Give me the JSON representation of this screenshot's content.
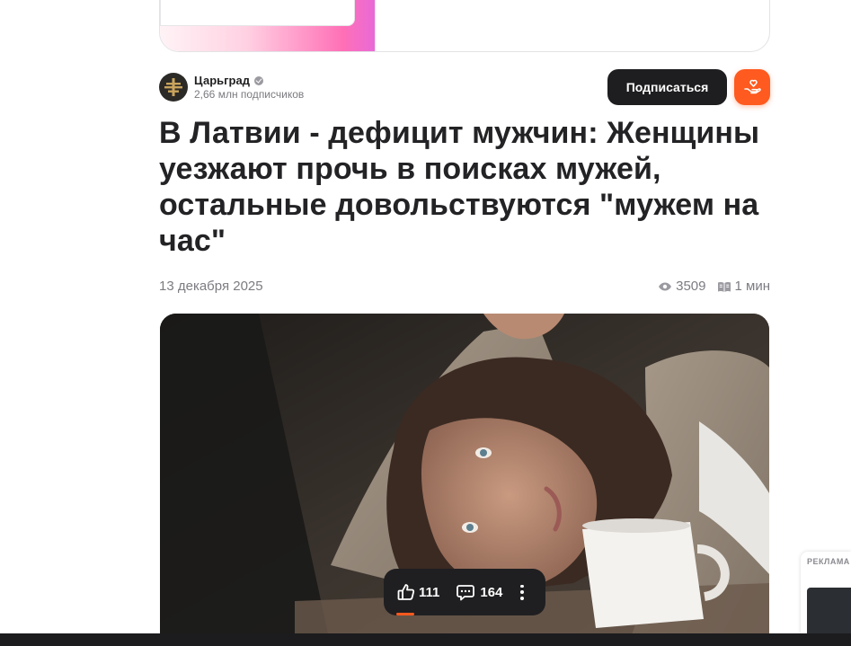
{
  "channel": {
    "name": "Царьград",
    "subscribers": "2,66 млн подписчиков",
    "subscribe_label": "Подписаться"
  },
  "article": {
    "title": "В Латвии - дефицит мужчин: Женщины уезжают прочь в поисках мужей, остальные довольствуются \"мужем на час\"",
    "date": "13 декабря 2025",
    "views": "3509",
    "read_time": "1 мин"
  },
  "actions": {
    "likes": "111",
    "comments": "164"
  },
  "ad": {
    "label": "РЕКЛАМА"
  },
  "colors": {
    "accent": "#ff5a1f",
    "dark_button": "#1e1e20"
  },
  "icons": {
    "views": "eye-icon",
    "read_time": "book-icon",
    "like": "thumbs-up-icon",
    "comment": "comment-icon",
    "more": "more-vertical-icon",
    "donate": "hand-heart-icon",
    "verified": "verified-icon"
  }
}
